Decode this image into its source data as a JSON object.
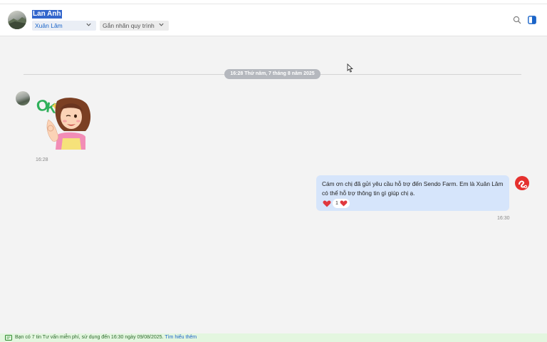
{
  "header": {
    "contact_name": "Lan Anh",
    "assigned_agent": "Xuân Lâm",
    "tag_placeholder": "Gắn nhãn quy trình"
  },
  "conversation": {
    "date_separator": "16:28 Thứ năm, 7 tháng 8 năm 2025",
    "incoming": {
      "sticker": "ok-girl-wink-sticker",
      "time": "16:28"
    },
    "outgoing": {
      "text": "Cám ơn chị đã gửi yêu cầu hỗ trợ đến Sendo Farm. Em là Xuân Lâm có thể hỗ trợ thông tin gì giúp chị ạ.",
      "reaction_count": "1",
      "time": "16:30"
    }
  },
  "footer": {
    "notice": "Bạn có 7 tin Tư vấn miễn phí, sử dụng đến 16:30 ngày 09/08/2025.",
    "learn_more": "Tìm hiểu thêm"
  },
  "colors": {
    "accent": "#1a64c8",
    "outgoing_bubble": "#d6e5fb",
    "notice_bar": "#e3f6df",
    "heart": "#e0383e"
  }
}
